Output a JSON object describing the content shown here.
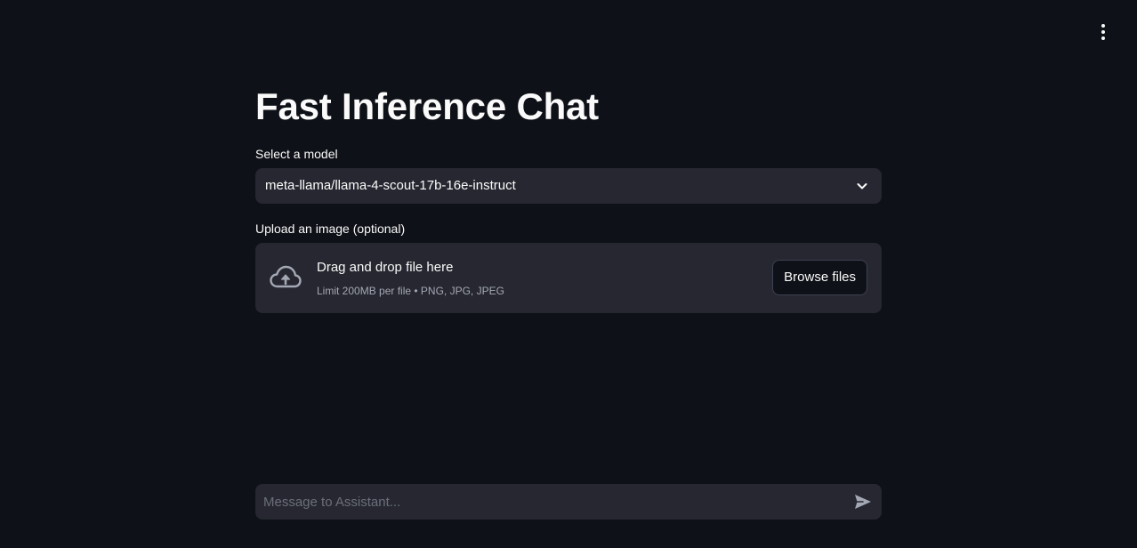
{
  "app": {
    "title": "Fast Inference Chat"
  },
  "toolbar": {
    "menu_icon": "vertical-ellipsis-icon"
  },
  "model_select": {
    "label": "Select a model",
    "value": "meta-llama/llama-4-scout-17b-16e-instruct",
    "icon": "chevron-down-icon"
  },
  "uploader": {
    "label": "Upload an image (optional)",
    "title": "Drag and drop file here",
    "hint": "Limit 200MB per file • PNG, JPG, JPEG",
    "button_label": "Browse files",
    "icon": "cloud-upload-icon"
  },
  "chat_input": {
    "value": "",
    "placeholder": "Message to Assistant...",
    "send_icon": "send-icon"
  },
  "colors": {
    "background": "#0e1117",
    "surface": "#262730",
    "text": "#fafafa",
    "muted_text": "#a3a8b4",
    "icon": "#a3a8b4"
  }
}
